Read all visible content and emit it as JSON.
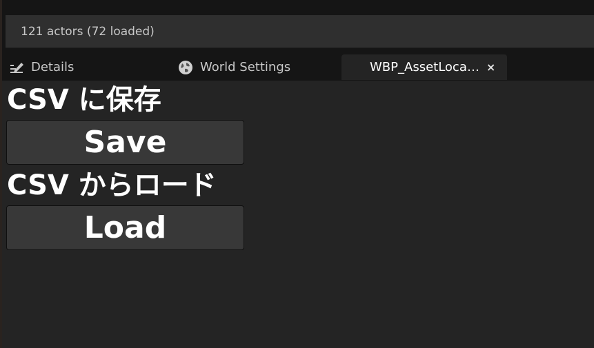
{
  "status_bar": {
    "text": "121 actors (72 loaded)"
  },
  "tabs": [
    {
      "label": "Details",
      "icon": "pencil-icon",
      "active": false
    },
    {
      "label": "World Settings",
      "icon": "globe-icon",
      "active": false
    },
    {
      "label": "WBP_AssetLoca…",
      "icon": "",
      "active": true,
      "close": "×"
    }
  ],
  "panel": {
    "save_heading": "CSV に保存",
    "save_button": "Save",
    "load_heading": "CSV からロード",
    "load_button": "Load"
  },
  "colors": {
    "background": "#151515",
    "panel": "#242424",
    "button": "#383838",
    "text": "#ffffff",
    "muted_text": "#c8c8c8"
  }
}
